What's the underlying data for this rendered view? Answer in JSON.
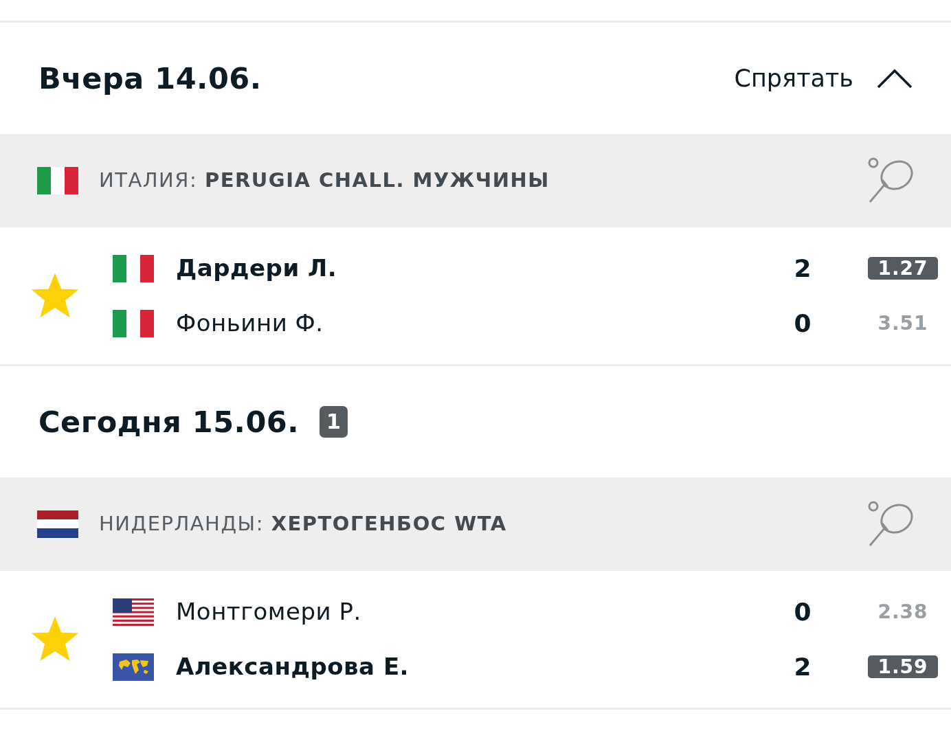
{
  "days": [
    {
      "title": "Вчера 14.06.",
      "toggle": {
        "label": "Спрятать",
        "expanded": true
      },
      "leagues": [
        {
          "flag": {
            "kind": "it"
          },
          "country": "ИТАЛИЯ:",
          "name": "PERUGIA CHALL. МУЖЧИНЫ",
          "matches": [
            {
              "favorite": true,
              "players": [
                {
                  "flag": {
                    "kind": "it"
                  },
                  "name": "Дардери Л.",
                  "score": "2",
                  "odds": "1.27",
                  "winner": true
                },
                {
                  "flag": {
                    "kind": "it"
                  },
                  "name": "Фоньини Ф.",
                  "score": "0",
                  "odds": "3.51",
                  "winner": false
                }
              ]
            }
          ]
        }
      ]
    },
    {
      "title": "Сегодня 15.06.",
      "badge": "1",
      "leagues": [
        {
          "flag": {
            "kind": "nl"
          },
          "country": "НИДЕРЛАНДЫ:",
          "name": "ХЕРТОГЕНБОС WTA",
          "matches": [
            {
              "favorite": true,
              "players": [
                {
                  "flag": {
                    "kind": "us"
                  },
                  "name": "Монтгомери Р.",
                  "score": "0",
                  "odds": "2.38",
                  "winner": false
                },
                {
                  "flag": {
                    "kind": "world"
                  },
                  "name": "Александрова Е.",
                  "score": "2",
                  "odds": "1.59",
                  "winner": true
                }
              ]
            }
          ]
        }
      ]
    }
  ]
}
